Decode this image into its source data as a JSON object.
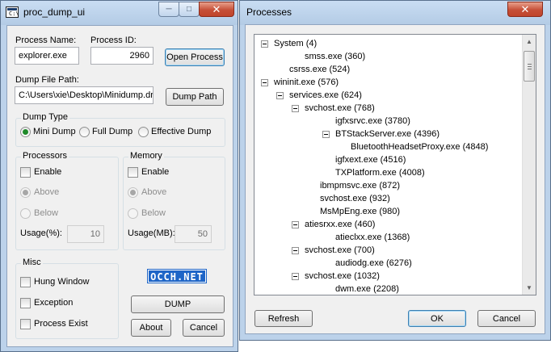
{
  "dump_window": {
    "title": "proc_dump_ui",
    "app_icon_text": "C:\\",
    "process_name_label": "Process Name:",
    "process_name_value": "explorer.exe",
    "process_id_label": "Process ID:",
    "process_id_value": "2960",
    "open_process_button": "Open Process",
    "dump_file_path_label": "Dump File Path:",
    "dump_file_path_value": "C:\\Users\\xie\\Desktop\\Minidump.dr",
    "dump_path_button": "Dump Path",
    "dump_type": {
      "title": "Dump Type",
      "options": [
        "Mini Dump",
        "Full Dump",
        "Effective Dump"
      ],
      "selected": "Mini Dump"
    },
    "processors": {
      "title": "Processors",
      "enable_label": "Enable",
      "above_label": "Above",
      "below_label": "Below",
      "usage_label": "Usage(%):",
      "usage_value": "10"
    },
    "memory": {
      "title": "Memory",
      "enable_label": "Enable",
      "above_label": "Above",
      "below_label": "Below",
      "usage_label": "Usage(MB):",
      "usage_value": "50"
    },
    "misc": {
      "title": "Misc",
      "hung_window_label": "Hung Window",
      "exception_label": "Exception",
      "process_exist_label": "Process Exist"
    },
    "logo_text": "OCCH.NET",
    "dump_button": "DUMP",
    "about_button": "About",
    "cancel_button": "Cancel"
  },
  "processes_window": {
    "title": "Processes",
    "tree": [
      {
        "label": "System (4)",
        "toggle": true
      },
      {
        "label": "smss.exe (360)",
        "toggle": false
      },
      {
        "label": "csrss.exe (524)",
        "toggle": false
      },
      {
        "label": "wininit.exe (576)",
        "toggle": true
      },
      {
        "label": "services.exe (624)",
        "toggle": true
      },
      {
        "label": "svchost.exe (768)",
        "toggle": true
      },
      {
        "label": "igfxsrvc.exe (3780)",
        "toggle": false
      },
      {
        "label": "BTStackServer.exe (4396)",
        "toggle": true
      },
      {
        "label": "BluetoothHeadsetProxy.exe (4848)",
        "toggle": false
      },
      {
        "label": "igfxext.exe (4516)",
        "toggle": false
      },
      {
        "label": "TXPlatform.exe (4008)",
        "toggle": false
      },
      {
        "label": "ibmpmsvc.exe (872)",
        "toggle": false
      },
      {
        "label": "svchost.exe (932)",
        "toggle": false
      },
      {
        "label": "MsMpEng.exe (980)",
        "toggle": false
      },
      {
        "label": "atiesrxx.exe (460)",
        "toggle": true
      },
      {
        "label": "atieclxx.exe (1368)",
        "toggle": false
      },
      {
        "label": "svchost.exe (700)",
        "toggle": true
      },
      {
        "label": "audiodg.exe (6276)",
        "toggle": false
      },
      {
        "label": "svchost.exe (1032)",
        "toggle": true
      },
      {
        "label": "dwm.exe (2208)",
        "toggle": false
      }
    ],
    "refresh_button": "Refresh",
    "ok_button": "OK",
    "cancel_button": "Cancel"
  }
}
